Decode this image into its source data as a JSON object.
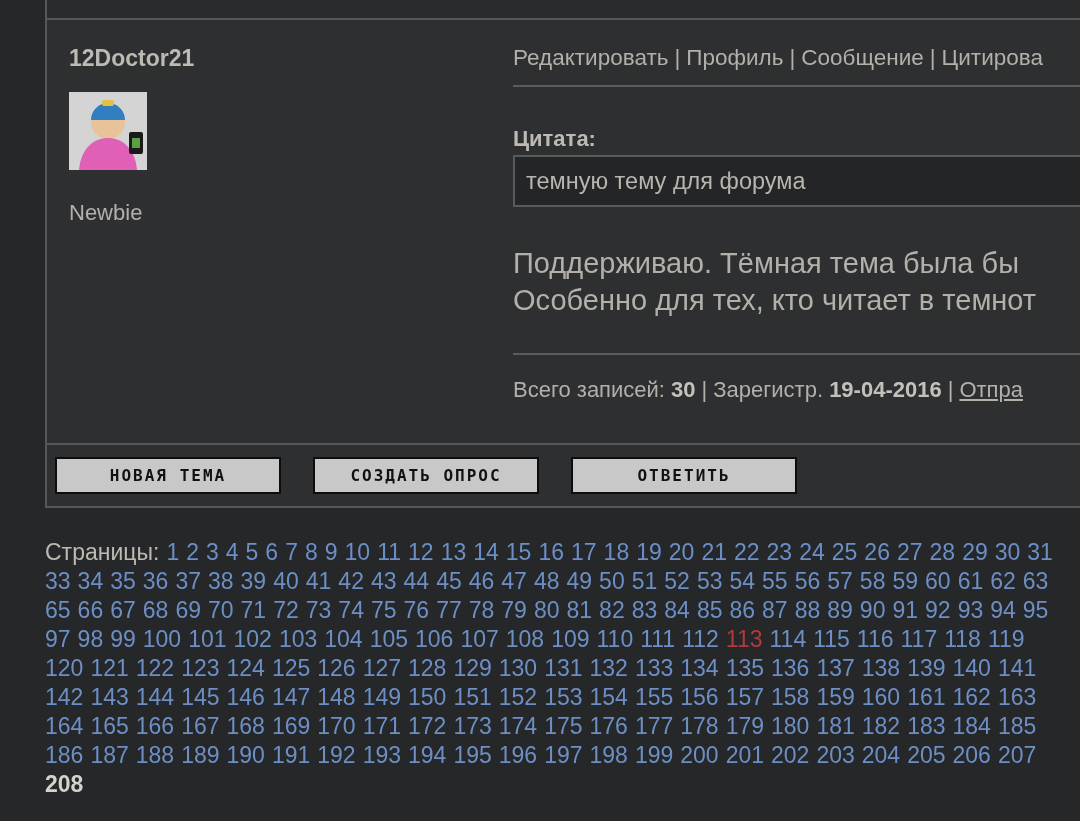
{
  "post": {
    "author": "12Doctor21",
    "rank": "Newbie",
    "separator": "|",
    "actions": [
      "Редактировать",
      "Профиль",
      "Сообщение",
      "Цитирова"
    ],
    "quote": {
      "label": "Цитата:",
      "text": "темную тему для форума"
    },
    "message": [
      "Поддерживаю. Тёмная тема была бы",
      "Особенно для тех, кто читает в темнот"
    ],
    "footer": {
      "stats": [
        "Всего записей: **30**",
        "Зарегистр. **19-04-2016**"
      ],
      "link": "Отпра"
    }
  },
  "buttons": [
    "НОВАЯ ТЕМА",
    "СОЗДАТЬ ОПРОС",
    "ОТВЕТИТЬ"
  ],
  "pagination": {
    "label": "Страницы:",
    "rows": [
      {
        "items": [
          {
            "n": "1",
            "kind": "link"
          },
          {
            "n": "2",
            "kind": "link"
          },
          {
            "n": "3",
            "kind": "link"
          },
          {
            "n": "4",
            "kind": "link"
          },
          {
            "n": "5",
            "kind": "link"
          },
          {
            "n": "6",
            "kind": "link"
          },
          {
            "n": "7",
            "kind": "link"
          },
          {
            "n": "8",
            "kind": "link"
          },
          {
            "n": "9",
            "kind": "link"
          },
          {
            "n": "10",
            "kind": "link"
          },
          {
            "n": "11",
            "kind": "link"
          },
          {
            "n": "12",
            "kind": "link"
          },
          {
            "n": "13",
            "kind": "link"
          },
          {
            "n": "14",
            "kind": "link"
          },
          {
            "n": "15",
            "kind": "link"
          },
          {
            "n": "16",
            "kind": "link"
          },
          {
            "n": "17",
            "kind": "link"
          },
          {
            "n": "18",
            "kind": "link"
          },
          {
            "n": "19",
            "kind": "link"
          },
          {
            "n": "20",
            "kind": "link"
          },
          {
            "n": "21",
            "kind": "link"
          },
          {
            "n": "22",
            "kind": "link"
          },
          {
            "n": "23",
            "kind": "link"
          },
          {
            "n": "24",
            "kind": "link"
          },
          {
            "n": "25",
            "kind": "link"
          },
          {
            "n": "26",
            "kind": "link"
          },
          {
            "n": "27",
            "kind": "link"
          },
          {
            "n": "28",
            "kind": "link"
          },
          {
            "n": "29",
            "kind": "link"
          },
          {
            "n": "30",
            "kind": "link"
          },
          {
            "n": "31",
            "kind": "link"
          }
        ]
      },
      {
        "items": [
          {
            "n": "33",
            "kind": "link"
          },
          {
            "n": "34",
            "kind": "link"
          },
          {
            "n": "35",
            "kind": "link"
          },
          {
            "n": "36",
            "kind": "link"
          },
          {
            "n": "37",
            "kind": "link"
          },
          {
            "n": "38",
            "kind": "link"
          },
          {
            "n": "39",
            "kind": "link"
          },
          {
            "n": "40",
            "kind": "link"
          },
          {
            "n": "41",
            "kind": "link"
          },
          {
            "n": "42",
            "kind": "link"
          },
          {
            "n": "43",
            "kind": "link"
          },
          {
            "n": "44",
            "kind": "link"
          },
          {
            "n": "45",
            "kind": "link"
          },
          {
            "n": "46",
            "kind": "link"
          },
          {
            "n": "47",
            "kind": "link"
          },
          {
            "n": "48",
            "kind": "link"
          },
          {
            "n": "49",
            "kind": "link"
          },
          {
            "n": "50",
            "kind": "link"
          },
          {
            "n": "51",
            "kind": "link"
          },
          {
            "n": "52",
            "kind": "link"
          },
          {
            "n": "53",
            "kind": "link"
          },
          {
            "n": "54",
            "kind": "link"
          },
          {
            "n": "55",
            "kind": "link"
          },
          {
            "n": "56",
            "kind": "link"
          },
          {
            "n": "57",
            "kind": "link"
          },
          {
            "n": "58",
            "kind": "link"
          },
          {
            "n": "59",
            "kind": "link"
          },
          {
            "n": "60",
            "kind": "link"
          },
          {
            "n": "61",
            "kind": "link"
          },
          {
            "n": "62",
            "kind": "link"
          },
          {
            "n": "63",
            "kind": "link"
          }
        ]
      },
      {
        "items": [
          {
            "n": "65",
            "kind": "link"
          },
          {
            "n": "66",
            "kind": "link"
          },
          {
            "n": "67",
            "kind": "link"
          },
          {
            "n": "68",
            "kind": "link"
          },
          {
            "n": "69",
            "kind": "link"
          },
          {
            "n": "70",
            "kind": "link"
          },
          {
            "n": "71",
            "kind": "link"
          },
          {
            "n": "72",
            "kind": "link"
          },
          {
            "n": "73",
            "kind": "link"
          },
          {
            "n": "74",
            "kind": "link"
          },
          {
            "n": "75",
            "kind": "link"
          },
          {
            "n": "76",
            "kind": "link"
          },
          {
            "n": "77",
            "kind": "link"
          },
          {
            "n": "78",
            "kind": "link"
          },
          {
            "n": "79",
            "kind": "link"
          },
          {
            "n": "80",
            "kind": "link"
          },
          {
            "n": "81",
            "kind": "link"
          },
          {
            "n": "82",
            "kind": "link"
          },
          {
            "n": "83",
            "kind": "link"
          },
          {
            "n": "84",
            "kind": "link"
          },
          {
            "n": "85",
            "kind": "link"
          },
          {
            "n": "86",
            "kind": "link"
          },
          {
            "n": "87",
            "kind": "link"
          },
          {
            "n": "88",
            "kind": "link"
          },
          {
            "n": "89",
            "kind": "link"
          },
          {
            "n": "90",
            "kind": "link"
          },
          {
            "n": "91",
            "kind": "link"
          },
          {
            "n": "92",
            "kind": "link"
          },
          {
            "n": "93",
            "kind": "link"
          },
          {
            "n": "94",
            "kind": "link"
          },
          {
            "n": "95",
            "kind": "link"
          }
        ]
      },
      {
        "items": [
          {
            "n": "97",
            "kind": "link"
          },
          {
            "n": "98",
            "kind": "link"
          },
          {
            "n": "99",
            "kind": "link"
          },
          {
            "n": "100",
            "kind": "link"
          },
          {
            "n": "101",
            "kind": "link"
          },
          {
            "n": "102",
            "kind": "link"
          },
          {
            "n": "103",
            "kind": "link"
          },
          {
            "n": "104",
            "kind": "link"
          },
          {
            "n": "105",
            "kind": "link"
          },
          {
            "n": "106",
            "kind": "link"
          },
          {
            "n": "107",
            "kind": "link"
          },
          {
            "n": "108",
            "kind": "link"
          },
          {
            "n": "109",
            "kind": "link"
          },
          {
            "n": "110",
            "kind": "link"
          },
          {
            "n": "111",
            "kind": "link"
          },
          {
            "n": "112",
            "kind": "link"
          },
          {
            "n": "113",
            "kind": "visited"
          },
          {
            "n": "114",
            "kind": "link"
          },
          {
            "n": "115",
            "kind": "link"
          },
          {
            "n": "116",
            "kind": "link"
          },
          {
            "n": "117",
            "kind": "link"
          },
          {
            "n": "118",
            "kind": "link"
          },
          {
            "n": "119",
            "kind": "link"
          }
        ]
      },
      {
        "items": [
          {
            "n": "120",
            "kind": "link"
          },
          {
            "n": "121",
            "kind": "link"
          },
          {
            "n": "122",
            "kind": "link"
          },
          {
            "n": "123",
            "kind": "link"
          },
          {
            "n": "124",
            "kind": "link"
          },
          {
            "n": "125",
            "kind": "link"
          },
          {
            "n": "126",
            "kind": "link"
          },
          {
            "n": "127",
            "kind": "link"
          },
          {
            "n": "128",
            "kind": "link"
          },
          {
            "n": "129",
            "kind": "link"
          },
          {
            "n": "130",
            "kind": "link"
          },
          {
            "n": "131",
            "kind": "link"
          },
          {
            "n": "132",
            "kind": "link"
          },
          {
            "n": "133",
            "kind": "link"
          },
          {
            "n": "134",
            "kind": "link"
          },
          {
            "n": "135",
            "kind": "link"
          },
          {
            "n": "136",
            "kind": "link"
          },
          {
            "n": "137",
            "kind": "link"
          },
          {
            "n": "138",
            "kind": "link"
          },
          {
            "n": "139",
            "kind": "link"
          },
          {
            "n": "140",
            "kind": "link"
          },
          {
            "n": "141",
            "kind": "link"
          }
        ]
      },
      {
        "items": [
          {
            "n": "142",
            "kind": "link"
          },
          {
            "n": "143",
            "kind": "link"
          },
          {
            "n": "144",
            "kind": "link"
          },
          {
            "n": "145",
            "kind": "link"
          },
          {
            "n": "146",
            "kind": "link"
          },
          {
            "n": "147",
            "kind": "link"
          },
          {
            "n": "148",
            "kind": "link"
          },
          {
            "n": "149",
            "kind": "link"
          },
          {
            "n": "150",
            "kind": "link"
          },
          {
            "n": "151",
            "kind": "link"
          },
          {
            "n": "152",
            "kind": "link"
          },
          {
            "n": "153",
            "kind": "link"
          },
          {
            "n": "154",
            "kind": "link"
          },
          {
            "n": "155",
            "kind": "link"
          },
          {
            "n": "156",
            "kind": "link"
          },
          {
            "n": "157",
            "kind": "link"
          },
          {
            "n": "158",
            "kind": "link"
          },
          {
            "n": "159",
            "kind": "link"
          },
          {
            "n": "160",
            "kind": "link"
          },
          {
            "n": "161",
            "kind": "link"
          },
          {
            "n": "162",
            "kind": "link"
          },
          {
            "n": "163",
            "kind": "link"
          }
        ]
      },
      {
        "items": [
          {
            "n": "164",
            "kind": "link"
          },
          {
            "n": "165",
            "kind": "link"
          },
          {
            "n": "166",
            "kind": "link"
          },
          {
            "n": "167",
            "kind": "link"
          },
          {
            "n": "168",
            "kind": "link"
          },
          {
            "n": "169",
            "kind": "link"
          },
          {
            "n": "170",
            "kind": "link"
          },
          {
            "n": "171",
            "kind": "link"
          },
          {
            "n": "172",
            "kind": "link"
          },
          {
            "n": "173",
            "kind": "link"
          },
          {
            "n": "174",
            "kind": "link"
          },
          {
            "n": "175",
            "kind": "link"
          },
          {
            "n": "176",
            "kind": "link"
          },
          {
            "n": "177",
            "kind": "link"
          },
          {
            "n": "178",
            "kind": "link"
          },
          {
            "n": "179",
            "kind": "link"
          },
          {
            "n": "180",
            "kind": "link"
          },
          {
            "n": "181",
            "kind": "link"
          },
          {
            "n": "182",
            "kind": "link"
          },
          {
            "n": "183",
            "kind": "link"
          },
          {
            "n": "184",
            "kind": "link"
          },
          {
            "n": "185",
            "kind": "link"
          }
        ]
      },
      {
        "items": [
          {
            "n": "186",
            "kind": "link"
          },
          {
            "n": "187",
            "kind": "link"
          },
          {
            "n": "188",
            "kind": "link"
          },
          {
            "n": "189",
            "kind": "link"
          },
          {
            "n": "190",
            "kind": "link"
          },
          {
            "n": "191",
            "kind": "link"
          },
          {
            "n": "192",
            "kind": "link"
          },
          {
            "n": "193",
            "kind": "link"
          },
          {
            "n": "194",
            "kind": "link"
          },
          {
            "n": "195",
            "kind": "link"
          },
          {
            "n": "196",
            "kind": "link"
          },
          {
            "n": "197",
            "kind": "link"
          },
          {
            "n": "198",
            "kind": "link"
          },
          {
            "n": "199",
            "kind": "link"
          },
          {
            "n": "200",
            "kind": "link"
          },
          {
            "n": "201",
            "kind": "link"
          },
          {
            "n": "202",
            "kind": "link"
          },
          {
            "n": "203",
            "kind": "link"
          },
          {
            "n": "204",
            "kind": "link"
          },
          {
            "n": "205",
            "kind": "link"
          },
          {
            "n": "206",
            "kind": "link"
          },
          {
            "n": "207",
            "kind": "link"
          }
        ]
      },
      {
        "items": [
          {
            "n": "208",
            "kind": "current"
          }
        ]
      }
    ]
  }
}
